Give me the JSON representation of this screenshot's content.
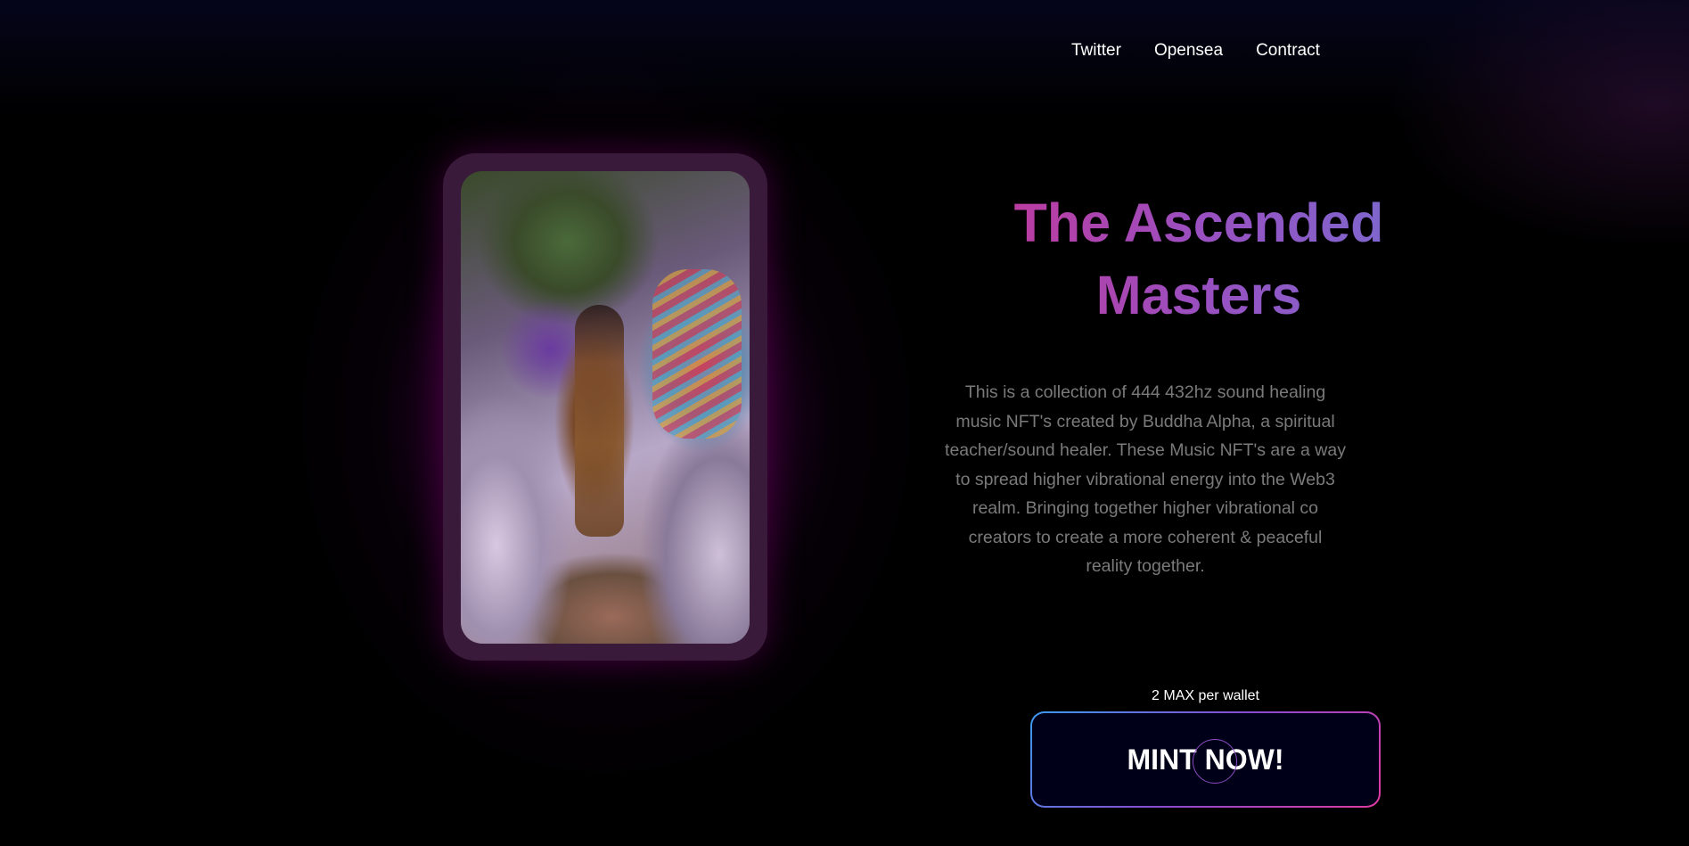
{
  "nav": {
    "items": [
      "Twitter",
      "Opensea",
      "Contract"
    ]
  },
  "hero": {
    "title": "The Ascended Masters",
    "description": "This is a collection of 444 432hz sound healing music NFT's created by Buddha Alpha, a spiritual teacher/sound healer. These Music NFT's are a way to spread higher vibrational energy into the Web3 realm. Bringing together higher vibrational co creators to create a more coherent & peaceful reality together."
  },
  "mint": {
    "limit_text": "2 MAX per wallet",
    "button_label": "MINT NOW!"
  },
  "colors": {
    "title_gradient_start": "#c0399c",
    "title_gradient_end": "#7a6ad0",
    "button_border_start": "#3a9aef",
    "button_border_end": "#e03aa0",
    "button_bg": "#000019",
    "glow": "#960078"
  }
}
